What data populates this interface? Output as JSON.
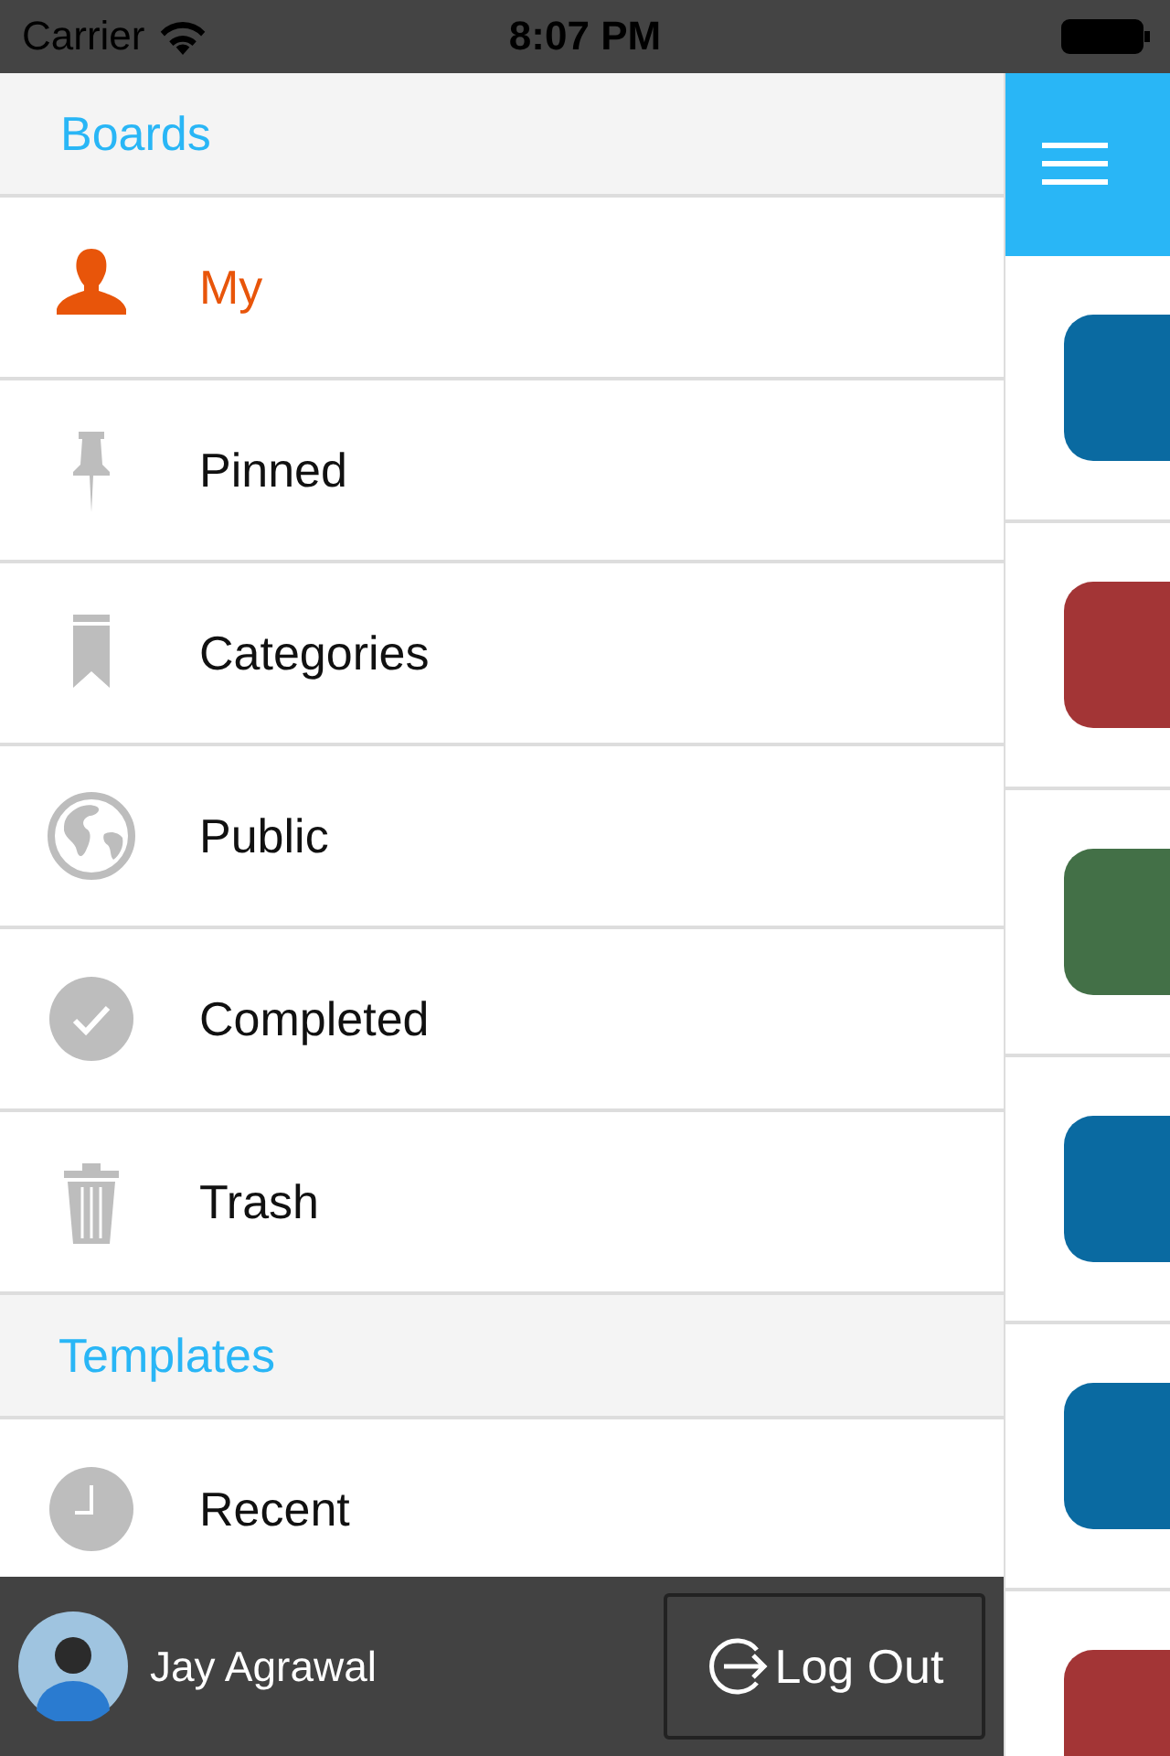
{
  "status_bar": {
    "carrier": "Carrier",
    "time": "8:07 PM"
  },
  "drawer": {
    "sections": [
      {
        "title": "Boards",
        "items": [
          {
            "label": "My",
            "kind": "person",
            "selected": true
          },
          {
            "label": "Pinned",
            "kind": "pin",
            "selected": false
          },
          {
            "label": "Categories",
            "kind": "bookmark",
            "selected": false
          },
          {
            "label": "Public",
            "kind": "globe",
            "selected": false
          },
          {
            "label": "Completed",
            "kind": "check",
            "selected": false
          },
          {
            "label": "Trash",
            "kind": "trash",
            "selected": false
          }
        ]
      },
      {
        "title": "Templates",
        "items": [
          {
            "label": "Recent",
            "kind": "clock",
            "selected": false
          }
        ]
      }
    ],
    "footer": {
      "user_name": "Jay Agrawal",
      "logout_button": "Log Out"
    }
  },
  "board_tiles": [
    {
      "color": "#0a6aa1"
    },
    {
      "color": "#a33536"
    },
    {
      "color": "#437047"
    },
    {
      "color": "#0a6aa1"
    },
    {
      "color": "#0a6aa1"
    },
    {
      "color": "#a33536"
    }
  ]
}
